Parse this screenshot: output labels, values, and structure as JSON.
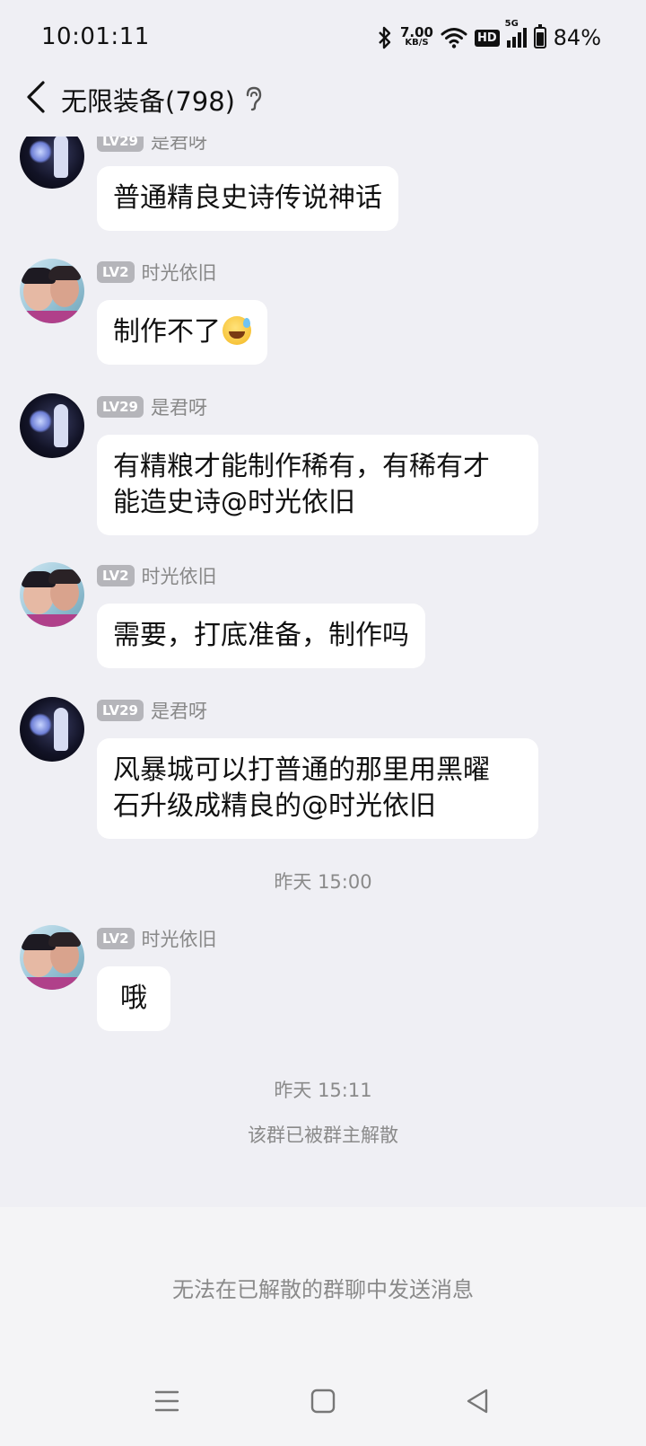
{
  "status_bar": {
    "time": "10:01:11",
    "net_speed_value": "7.00",
    "net_speed_unit": "KB/S",
    "hd_label": "HD",
    "network_type": "5G",
    "battery_percent": "84%",
    "battery_level": 0.84
  },
  "header": {
    "title": "无限装备(798)"
  },
  "messages": [
    {
      "level": "LV29",
      "nick": "是君呀",
      "text": "普通精良史诗传说神话",
      "avatar": "dark-figure"
    },
    {
      "level": "LV2",
      "nick": "时光依旧",
      "text": "制作不了",
      "emoji": "sweat-smile-emoji",
      "avatar": "couple-photo"
    },
    {
      "level": "LV29",
      "nick": "是君呀",
      "line1": "有精粮才能制作稀有，有稀有才",
      "line2": "能造史诗@时光依旧",
      "avatar": "dark-figure"
    },
    {
      "level": "LV2",
      "nick": "时光依旧",
      "text": "需要，打底准备，制作吗",
      "avatar": "couple-photo"
    },
    {
      "level": "LV29",
      "nick": "是君呀",
      "line1": "风暴城可以打普通的那里用黑曜",
      "line2": "石升级成精良的@时光依旧",
      "avatar": "dark-figure"
    },
    {
      "level": "LV2",
      "nick": "时光依旧",
      "text": "哦",
      "avatar": "couple-photo"
    }
  ],
  "timestamps": {
    "t1": "昨天 15:00",
    "t2": "昨天 15:11"
  },
  "system_notice": "该群已被群主解散",
  "input_disabled_hint": "无法在已解散的群聊中发送消息",
  "colors": {
    "background": "#efeff4",
    "bubble": "#ffffff",
    "level_badge": "#b5b5ba",
    "secondary_text": "#8a8a8a"
  }
}
